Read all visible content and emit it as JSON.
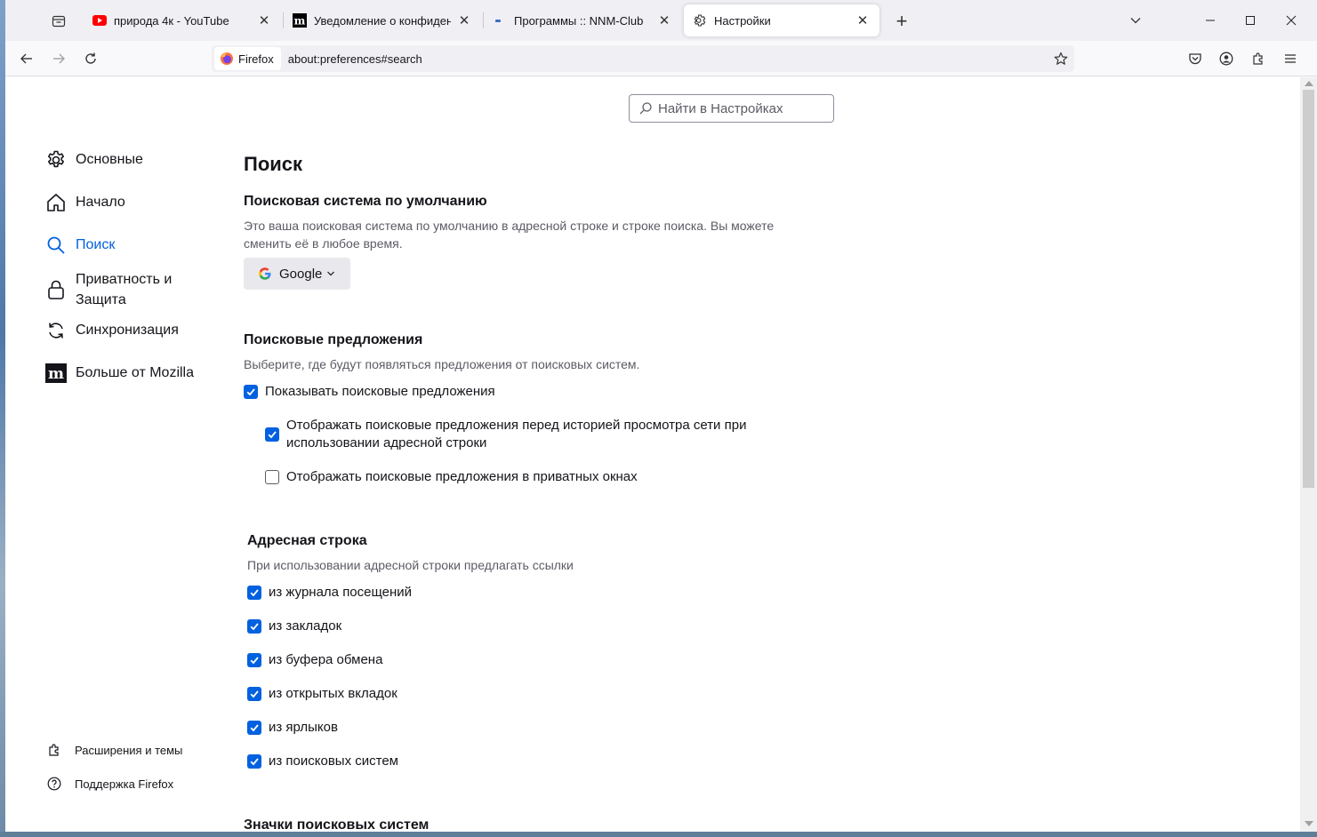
{
  "tabs": [
    {
      "title": "природа 4к - YouTube",
      "favicon": "youtube-icon"
    },
    {
      "title": "Уведомление о конфиденциа",
      "favicon": "mozilla-icon"
    },
    {
      "title": "Программы :: NNM-Club",
      "favicon": "nnm-icon"
    },
    {
      "title": "Настройки",
      "favicon": "gear-icon",
      "active": true
    }
  ],
  "urlbar": {
    "identity": "Firefox",
    "url": "about:preferences#search"
  },
  "search": {
    "placeholder": "Найти в Настройках"
  },
  "sidebar": {
    "items": [
      {
        "label": "Основные",
        "icon": "gear-icon"
      },
      {
        "label": "Начало",
        "icon": "home-icon"
      },
      {
        "label": "Поиск",
        "icon": "search-icon",
        "selected": true
      },
      {
        "label_line1": "Приватность и",
        "label_line2": "Защита",
        "icon": "lock-icon"
      },
      {
        "label": "Синхронизация",
        "icon": "sync-icon"
      },
      {
        "label": "Больше от Mozilla",
        "icon": "mozilla-icon"
      }
    ],
    "footer": [
      {
        "label": "Расширения и темы",
        "icon": "puzzle-icon"
      },
      {
        "label": "Поддержка Firefox",
        "icon": "help-icon"
      }
    ]
  },
  "main": {
    "title": "Поиск",
    "default_engine": {
      "heading": "Поисковая система по умолчанию",
      "desc_line1": "Это ваша поисковая система по умолчанию в адресной строке и строке поиска. Вы можете",
      "desc_line2": "сменить её в любое время.",
      "selected": "Google"
    },
    "suggestions": {
      "heading": "Поисковые предложения",
      "desc": "Выберите, где будут появляться предложения от поисковых систем.",
      "show": {
        "label": "Показывать поисковые предложения",
        "checked": true
      },
      "before_history": {
        "label_line1": "Отображать поисковые предложения перед историей просмотра сети при",
        "label_line2": "использовании адресной строки",
        "checked": true
      },
      "private": {
        "label": "Отображать поисковые предложения в приватных окнах",
        "checked": false
      }
    },
    "address_bar": {
      "heading": "Адресная строка",
      "desc": "При использовании адресной строки предлагать ссылки",
      "options": [
        {
          "label": "из журнала посещений",
          "checked": true
        },
        {
          "label": "из закладок",
          "checked": true
        },
        {
          "label": "из буфера обмена",
          "checked": true
        },
        {
          "label": "из открытых вкладок",
          "checked": true
        },
        {
          "label": "из ярлыков",
          "checked": true
        },
        {
          "label": "из поисковых систем",
          "checked": true
        }
      ]
    },
    "engine_icons_heading": "Значки поисковых систем"
  },
  "colors": {
    "accent": "#0061e0",
    "chrome": "#f0f0f4",
    "text": "#15141a",
    "muted": "#5b5b66"
  }
}
